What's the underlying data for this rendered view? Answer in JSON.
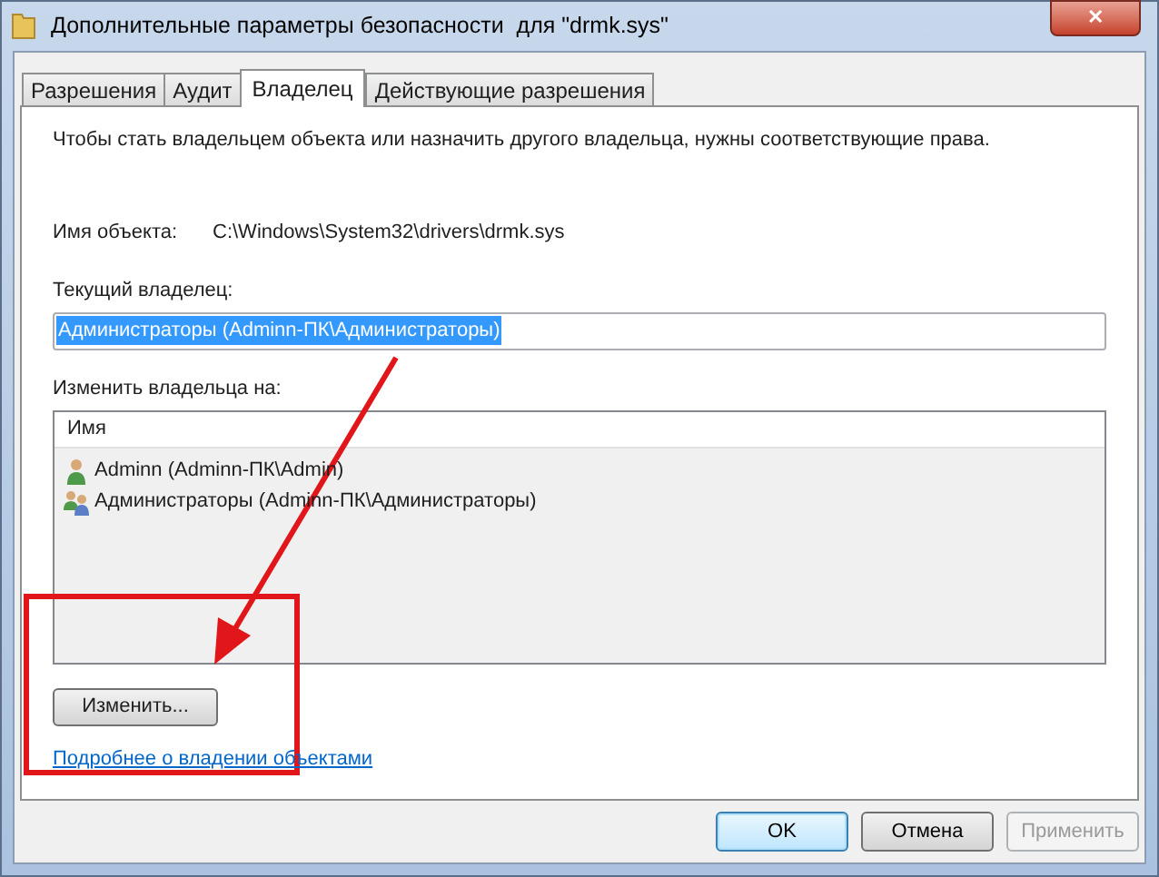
{
  "window": {
    "title": "Дополнительные параметры безопасности  для \"drmk.sys\"",
    "close": "✕"
  },
  "tabs": [
    {
      "label": "Разрешения",
      "selected": false
    },
    {
      "label": "Аудит",
      "selected": false
    },
    {
      "label": "Владелец",
      "selected": true
    },
    {
      "label": "Действующие разрешения",
      "selected": false
    }
  ],
  "description": "Чтобы стать владельцем объекта или назначить другого владельца, нужны соответствующие права.",
  "object": {
    "label": "Имя объекта:",
    "value": "C:\\Windows\\System32\\drivers\\drmk.sys"
  },
  "current_owner": {
    "label": "Текущий владелец:",
    "value": "Администраторы (Adminn-ПК\\Администраторы)"
  },
  "change_owner": {
    "label": "Изменить владельца на:",
    "column": "Имя",
    "items": [
      {
        "name": "Adminn (Adminn-ПК\\Admin)",
        "kind": "user"
      },
      {
        "name": "Администраторы (Adminn-ПК\\Администраторы)",
        "kind": "group"
      }
    ]
  },
  "change_button": "Изменить...",
  "link": "Подробнее о владении объектами",
  "buttons": [
    {
      "label": "OK",
      "default": true,
      "disabled": false
    },
    {
      "label": "Отмена",
      "default": false,
      "disabled": false
    },
    {
      "label": "Применить",
      "default": false,
      "disabled": true
    }
  ]
}
